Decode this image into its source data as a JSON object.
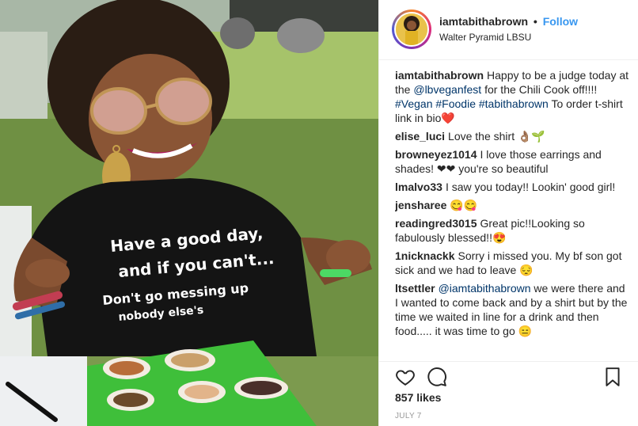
{
  "post": {
    "username": "iamtabithabrown",
    "follow_label": "Follow",
    "separator": "•",
    "location": "Walter Pyramid LBSU",
    "shirt_text": [
      "Have a good day,",
      "and if you can't...",
      "Don't go messing up",
      "nobody else's"
    ],
    "likes": "857 likes",
    "date": "JULY 7"
  },
  "caption": {
    "username": "iamtabithabrown",
    "text_before": "Happy to be a judge today at the ",
    "mention": "@lbveganfest",
    "text_middle": " for the Chili Cook off!!!! ",
    "tags": "#Vegan #Foodie #tabithabrown",
    "text_after": " To order t-shirt link in bio❤️"
  },
  "comments": [
    {
      "username": "elise_luci",
      "text": "Love the shirt 👌🏽🌱"
    },
    {
      "username": "browneyez1014",
      "text": "I love those earrings and shades! ❤❤ you're so beautiful"
    },
    {
      "username": "lmalvo33",
      "text": "I saw you today!! Lookin' good girl!"
    },
    {
      "username": "jensharee",
      "text": "😋😋"
    },
    {
      "username": "readingred3015",
      "text": "Great pic!!Looking so fabulously blessed!!😍"
    },
    {
      "username": "1nicknackk",
      "text": "Sorry i missed you. My bf son got sick and we had to leave 😔"
    },
    {
      "username": "ltsettler",
      "mention": "@iamtabithabrown",
      "text": " we were there and I wanted to come back and by a shirt but by the time we waited in line for a drink and then food..... it was time to go 😑"
    }
  ],
  "icons": {
    "like": "heart-outline-icon",
    "comment": "speech-bubble-icon",
    "save": "bookmark-icon"
  }
}
